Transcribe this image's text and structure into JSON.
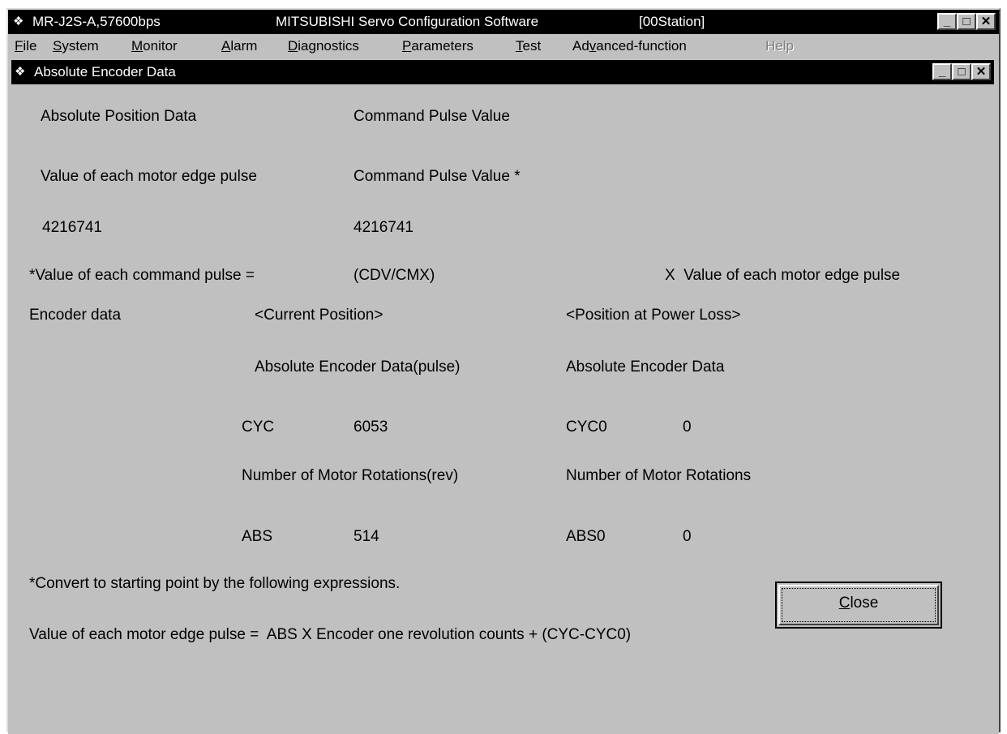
{
  "app": {
    "title_left": "MR-J2S-A,57600bps",
    "title_center": "MITSUBISHI Servo Configuration Software",
    "title_station": "[00Station]",
    "icon": "servo-app-icon"
  },
  "window_controls": {
    "minimize": "_",
    "maximize": "□",
    "close": "✕"
  },
  "menu": {
    "file": {
      "first": "F",
      "rest": "ile"
    },
    "system": {
      "first": "S",
      "rest": "ystem"
    },
    "monitor": {
      "first": "M",
      "rest": "onitor"
    },
    "alarm": {
      "first": "A",
      "rest": "larm"
    },
    "diagnostics": {
      "first": "D",
      "rest": "iagnostics"
    },
    "parameters": {
      "first": "P",
      "rest": "arameters"
    },
    "test": {
      "first": "T",
      "rest": "est"
    },
    "advanced": {
      "pre": "Ad",
      "ul": "v",
      "post": "anced-function"
    },
    "help": "Help"
  },
  "dialog": {
    "title": "Absolute Encoder Data",
    "absolute_position_data": "Absolute Position Data",
    "command_pulse_value": "Command Pulse Value",
    "value_each_motor_edge_pulse": "Value of each motor edge pulse",
    "command_pulse_value_star": "Command Pulse Value *",
    "motor_edge_pulse_value": "4216741",
    "command_pulse_numeric": "4216741",
    "formula_lhs": "*Value of each command pulse =",
    "formula_cdv": "(CDV/CMX)",
    "formula_rhs": "X  Value of each motor edge pulse",
    "encoder_data": "Encoder data",
    "current_position": "<Current Position>",
    "position_power_loss": "<Position at Power Loss>",
    "abs_enc_pulse": "Absolute Encoder Data(pulse)",
    "abs_enc": "Absolute Encoder Data",
    "cyc_label": "CYC",
    "cyc_value": "6053",
    "cyc0_label": "CYC0",
    "cyc0_value": "0",
    "motor_rot_rev": "Number of Motor Rotations(rev)",
    "motor_rot": "Number of Motor Rotations",
    "abs_label": "ABS",
    "abs_value": "514",
    "abs0_label": "ABS0",
    "abs0_value": "0",
    "note": "*Convert to starting point by the following expressions.",
    "expression": "Value of each motor edge pulse =  ABS X Encoder one revolution counts + (CYC-CYC0)",
    "close_first": "C",
    "close_rest": "lose"
  }
}
